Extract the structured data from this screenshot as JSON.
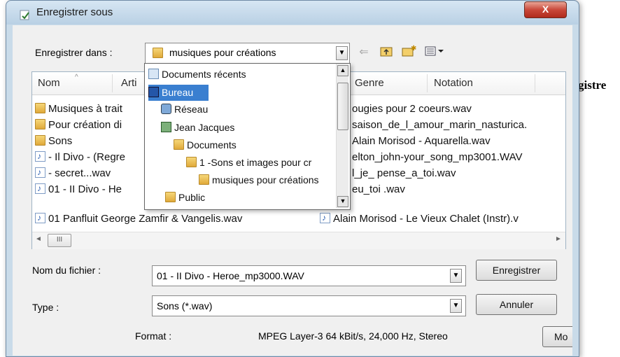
{
  "window": {
    "title": "Enregistrer sous",
    "close_label": "X"
  },
  "location": {
    "label": "Enregistrer dans :",
    "value": "musiques pour créations"
  },
  "toolbar": {
    "back_icon": "back-arrow-icon",
    "up_icon": "up-folder-icon",
    "newfolder_icon": "new-folder-icon",
    "views_icon": "views-icon"
  },
  "columns": [
    "Nom",
    "Arti",
    "Genre",
    "Notation"
  ],
  "files_left": [
    {
      "name": "Musiques à trait",
      "type": "folder"
    },
    {
      "name": "Pour création di",
      "type": "folder"
    },
    {
      "name": "Sons",
      "type": "folder"
    },
    {
      "name": "- Il Divo - (Regre",
      "type": "audio"
    },
    {
      "name": "- secret...wav",
      "type": "audio"
    },
    {
      "name": "01 - II Divo - He",
      "type": "audio"
    },
    {
      "name": "01 Panfluit George Zamfir & Vangelis.wav",
      "type": "audio"
    }
  ],
  "files_right": [
    "ougies pour 2 coeurs.wav",
    "saison_de_l_amour_marin_nasturica.",
    "Alain Morisod - Aquarella.wav",
    "elton_john-your_song_mp3001.WAV",
    "l_je_ pense_a_toi.wav",
    "eu_toi .wav",
    "Alain Morisod - Le Vieux Chalet (Instr).v"
  ],
  "dropdown": [
    {
      "label": "Documents récents",
      "indent": 0,
      "icon": "recent-docs-icon"
    },
    {
      "label": "Bureau",
      "indent": 0,
      "icon": "desktop-icon",
      "selected": true
    },
    {
      "label": "Réseau",
      "indent": 1,
      "icon": "network-icon"
    },
    {
      "label": "Jean Jacques",
      "indent": 1,
      "icon": "user-icon"
    },
    {
      "label": "Documents",
      "indent": 2,
      "icon": "folder-icon"
    },
    {
      "label": "1 -Sons et images pour cr",
      "indent": 3,
      "icon": "folder-icon"
    },
    {
      "label": "musiques pour créations",
      "indent": 4,
      "icon": "folder-icon"
    },
    {
      "label": "Public",
      "indent": 2,
      "icon": "folder-icon"
    }
  ],
  "scroll_label": "III",
  "filename": {
    "label": "Nom du fichier :",
    "value": "01 - II Divo - Heroe_mp3000.WAV"
  },
  "filetype": {
    "label": "Type :",
    "value": "Sons (*.wav)"
  },
  "buttons": {
    "save": "Enregistrer",
    "cancel": "Annuler",
    "more": "Mo"
  },
  "format": {
    "label": "Format :",
    "value": "MPEG Layer-3 64 kBit/s, 24,000 Hz, Stereo"
  },
  "background_text": "gistre"
}
